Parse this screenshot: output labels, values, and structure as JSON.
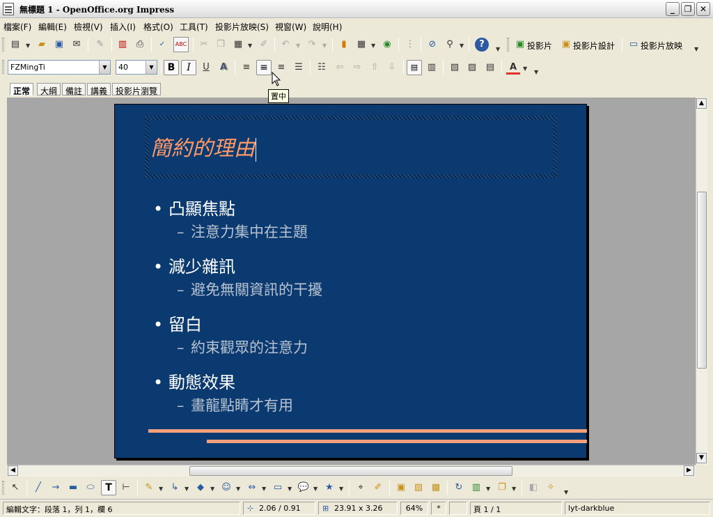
{
  "window": {
    "title": "無標題 1 - OpenOffice.org Impress",
    "buttons": {
      "minimize": "_",
      "maximize": "❐",
      "close": "✕"
    }
  },
  "menu": [
    "檔案(F)",
    "編輯(E)",
    "檢視(V)",
    "插入(I)",
    "格式(O)",
    "工具(T)",
    "投影片放映(S)",
    "視窗(W)",
    "說明(H)"
  ],
  "toolbar": {
    "slide_label": "投影片",
    "slide_design_label": "投影片設計",
    "slideshow_label": "投影片放映",
    "icons": [
      "new-icon",
      "open-icon",
      "save-icon",
      "email-icon",
      "edit-file-icon",
      "export-pdf-icon",
      "print-icon",
      "spellcheck-icon",
      "autospellcheck-icon",
      "cut-icon",
      "copy-icon",
      "paste-icon",
      "format-paintbrush-icon",
      "undo-icon",
      "redo-icon",
      "chart-icon",
      "table-icon",
      "show-draw-functions-icon",
      "grid-icon",
      "navigator-icon",
      "zoom-icon",
      "help-icon"
    ]
  },
  "formatting": {
    "font_name": "FZMingTi",
    "font_size": "40",
    "bold": "B",
    "italic": "I",
    "underline": "U",
    "shadow": "A",
    "font_color": "A"
  },
  "tabs": [
    "正常",
    "大綱",
    "備註",
    "講義",
    "投影片瀏覽"
  ],
  "tooltip": "置中",
  "slide": {
    "title": "簡約的理由",
    "bullets": [
      {
        "main": "凸顯焦點",
        "sub": "注意力集中在主題"
      },
      {
        "main": "減少雜訊",
        "sub": "避免無關資訊的干擾"
      },
      {
        "main": "留白",
        "sub": "約束觀眾的注意力"
      },
      {
        "main": "動態效果",
        "sub": "畫龍點睛才有用"
      }
    ],
    "colors": {
      "background": "#0b3a70",
      "title": "#ff9966",
      "accent_lines": "#f4a07a"
    }
  },
  "status": {
    "text": "編輯文字：段落 1，列 1，欄 6",
    "position": "2.06 / 0.91",
    "size": "23.91 x 3.26",
    "zoom": "64%",
    "modified": "*",
    "page": "頁 1 / 1",
    "layout": "lyt-darkblue"
  }
}
